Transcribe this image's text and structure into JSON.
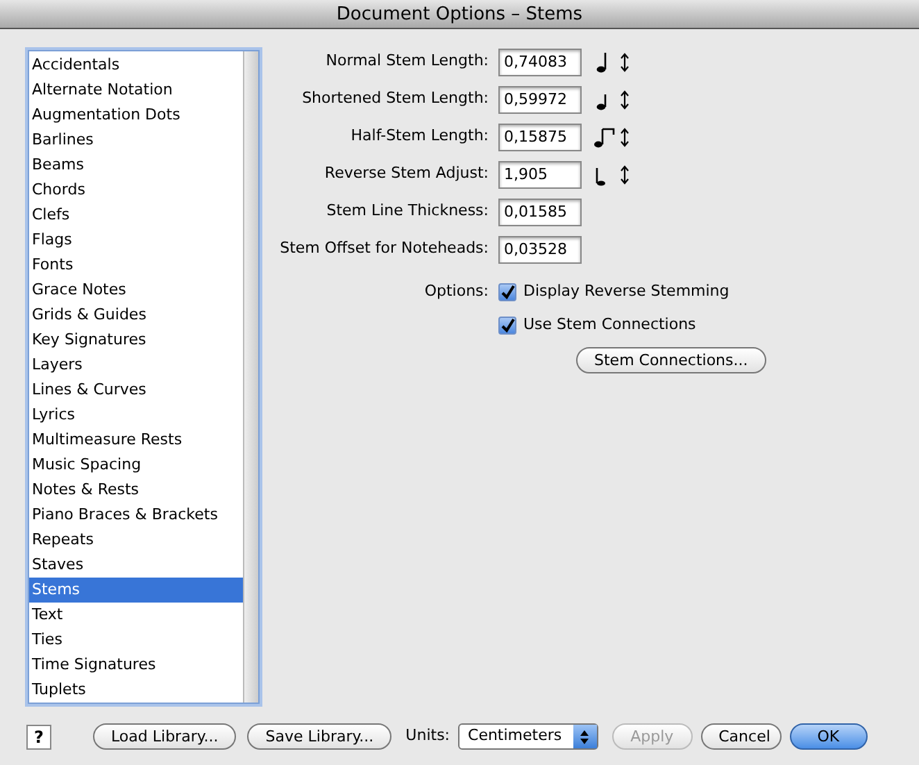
{
  "window": {
    "title": "Document Options – Stems"
  },
  "sidebar": {
    "items": [
      {
        "label": "Accidentals",
        "selected": false
      },
      {
        "label": "Alternate Notation",
        "selected": false
      },
      {
        "label": "Augmentation Dots",
        "selected": false
      },
      {
        "label": "Barlines",
        "selected": false
      },
      {
        "label": "Beams",
        "selected": false
      },
      {
        "label": "Chords",
        "selected": false
      },
      {
        "label": "Clefs",
        "selected": false
      },
      {
        "label": "Flags",
        "selected": false
      },
      {
        "label": "Fonts",
        "selected": false
      },
      {
        "label": "Grace Notes",
        "selected": false
      },
      {
        "label": "Grids & Guides",
        "selected": false
      },
      {
        "label": "Key Signatures",
        "selected": false
      },
      {
        "label": "Layers",
        "selected": false
      },
      {
        "label": "Lines & Curves",
        "selected": false
      },
      {
        "label": "Lyrics",
        "selected": false
      },
      {
        "label": "Multimeasure Rests",
        "selected": false
      },
      {
        "label": "Music Spacing",
        "selected": false
      },
      {
        "label": "Notes & Rests",
        "selected": false
      },
      {
        "label": "Piano Braces & Brackets",
        "selected": false
      },
      {
        "label": "Repeats",
        "selected": false
      },
      {
        "label": "Staves",
        "selected": false
      },
      {
        "label": "Stems",
        "selected": true
      },
      {
        "label": "Text",
        "selected": false
      },
      {
        "label": "Ties",
        "selected": false
      },
      {
        "label": "Time Signatures",
        "selected": false
      },
      {
        "label": "Tuplets",
        "selected": false
      }
    ]
  },
  "fields": [
    {
      "label": "Normal Stem Length:",
      "value": "0,74083"
    },
    {
      "label": "Shortened Stem Length:",
      "value": "0,59972"
    },
    {
      "label": "Half-Stem Length:",
      "value": "0,15875"
    },
    {
      "label": "Reverse Stem Adjust:",
      "value": "1,905"
    },
    {
      "label": "Stem Line Thickness:",
      "value": "0,01585"
    },
    {
      "label": "Stem Offset for Noteheads:",
      "value": "0,03528"
    }
  ],
  "options": {
    "label": "Options:",
    "checkboxes": [
      {
        "label": "Display Reverse Stemming",
        "checked": true
      },
      {
        "label": "Use Stem Connections",
        "checked": true
      }
    ]
  },
  "stem_connections_button": "Stem Connections...",
  "help_button": "?",
  "footer": {
    "load": "Load Library...",
    "save": "Save Library...",
    "units_label": "Units:",
    "units_value": "Centimeters",
    "buttons": [
      {
        "label": "Apply",
        "disabled": true,
        "default": false
      },
      {
        "label": "Cancel",
        "disabled": false,
        "default": false
      },
      {
        "label": "OK",
        "disabled": false,
        "default": true
      }
    ]
  }
}
